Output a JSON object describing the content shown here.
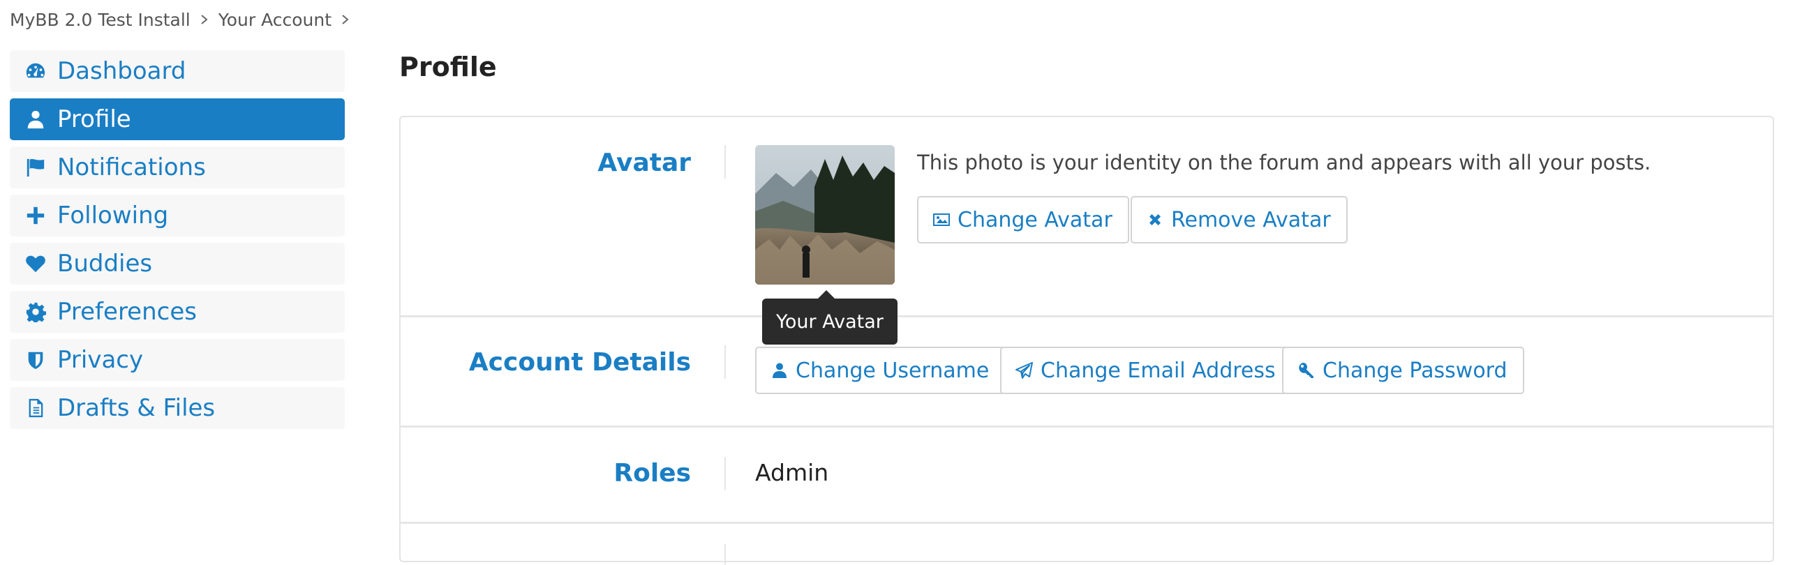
{
  "breadcrumb": [
    "MyBB 2.0 Test Install",
    "Your Account"
  ],
  "sidebar": {
    "items": [
      {
        "label": "Dashboard",
        "icon": "dashboard-icon"
      },
      {
        "label": "Profile",
        "icon": "user-icon",
        "active": true
      },
      {
        "label": "Notifications",
        "icon": "flag-icon"
      },
      {
        "label": "Following",
        "icon": "plus-icon"
      },
      {
        "label": "Buddies",
        "icon": "heart-icon"
      },
      {
        "label": "Preferences",
        "icon": "gear-icon"
      },
      {
        "label": "Privacy",
        "icon": "shield-icon"
      },
      {
        "label": "Drafts & Files",
        "icon": "document-icon"
      }
    ]
  },
  "main": {
    "title": "Profile",
    "avatar": {
      "label": "Avatar",
      "description": "This photo is your identity on the forum and appears with all your posts.",
      "change_button": "Change Avatar",
      "remove_button": "Remove Avatar",
      "tooltip": "Your Avatar"
    },
    "account_details": {
      "label": "Account Details",
      "change_username": "Change Username",
      "change_email": "Change Email Address",
      "change_password": "Change Password"
    },
    "roles": {
      "label": "Roles",
      "value": "Admin"
    }
  },
  "colors": {
    "accent": "#1a7ec4",
    "tooltip_bg": "#2b2b2b"
  }
}
